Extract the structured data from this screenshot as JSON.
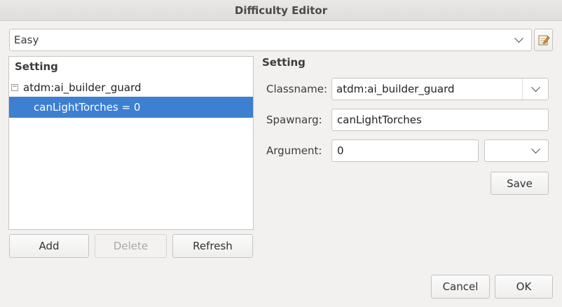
{
  "window": {
    "title": "Difficulty Editor"
  },
  "difficulty_select": {
    "value": "Easy"
  },
  "tree": {
    "header": "Setting",
    "group_label": "atdm:ai_builder_guard",
    "expander": "−",
    "selected_item": "canLightTorches = 0"
  },
  "list_buttons": {
    "add": "Add",
    "delete": "Delete",
    "refresh": "Refresh"
  },
  "form": {
    "section_title": "Setting",
    "classname_label": "Classname:",
    "classname_value": "atdm:ai_builder_guard",
    "spawnarg_label": "Spawnarg:",
    "spawnarg_value": "canLightTorches",
    "argument_label": "Argument:",
    "argument_value": "0",
    "argument_type_value": "",
    "save_label": "Save"
  },
  "dialog_buttons": {
    "cancel": "Cancel",
    "ok": "OK"
  },
  "colors": {
    "selection": "#3d7fd1",
    "window_bg": "#f2f1f0"
  },
  "icons": {
    "edit": "edit-note-icon"
  }
}
